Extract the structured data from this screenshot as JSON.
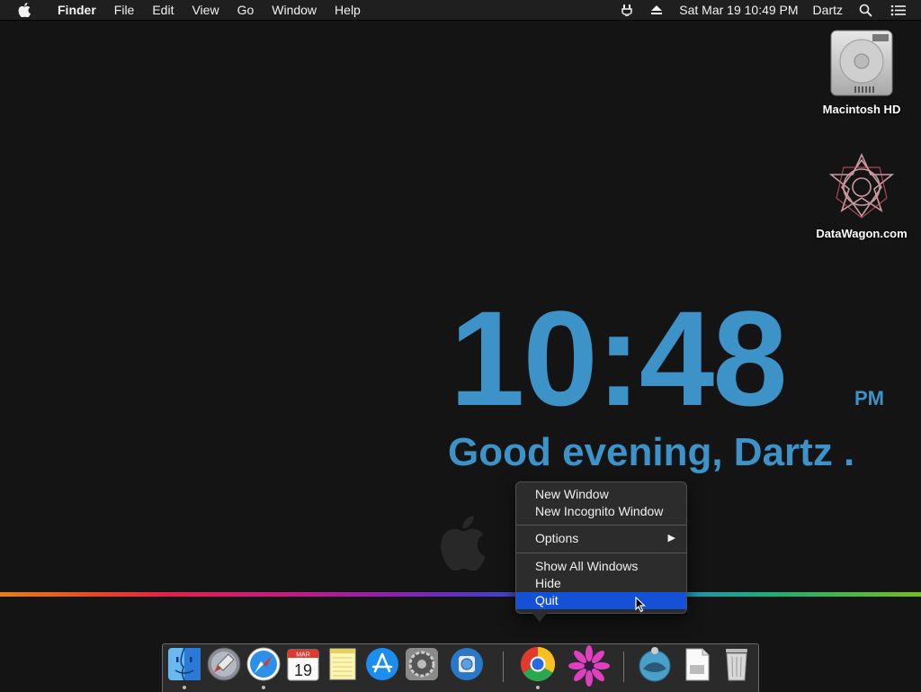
{
  "menubar": {
    "app_name": "Finder",
    "items": [
      "File",
      "Edit",
      "View",
      "Go",
      "Window",
      "Help"
    ],
    "datetime": "Sat Mar 19  10:49 PM",
    "user": "Dartz"
  },
  "desktop": {
    "icons": [
      {
        "label": "Macintosh HD",
        "icon": "hard-drive-icon"
      },
      {
        "label": "DataWagon.com",
        "icon": "datawagon-icon"
      }
    ]
  },
  "widget": {
    "time": "10:48",
    "ampm": "PM",
    "greeting": "Good evening, Dartz .",
    "color": "#3d92c8"
  },
  "context_menu": {
    "items": [
      "New Window",
      "New Incognito Window",
      "Options",
      "Show All Windows",
      "Hide",
      "Quit"
    ],
    "highlighted": "Quit",
    "highlight_color": "#1550d8"
  },
  "dock": {
    "apps": [
      {
        "name": "Finder",
        "icon": "finder-icon",
        "running": true
      },
      {
        "name": "Launchpad",
        "icon": "launchpad-icon",
        "running": false
      },
      {
        "name": "Safari",
        "icon": "safari-icon",
        "running": true
      },
      {
        "name": "Calendar",
        "icon": "calendar-icon",
        "running": false,
        "month": "MAR",
        "day": "19"
      },
      {
        "name": "Notes",
        "icon": "notes-icon",
        "running": false
      },
      {
        "name": "App Store",
        "icon": "app-store-icon",
        "running": false
      },
      {
        "name": "System Preferences",
        "icon": "system-preferences-icon",
        "running": false
      },
      {
        "name": "Time Machine",
        "icon": "time-machine-icon",
        "running": false
      },
      {
        "name": "Google Chrome",
        "icon": "chrome-icon",
        "running": true
      },
      {
        "name": "Flower",
        "icon": "flower-icon",
        "running": false
      },
      {
        "name": "Downloads",
        "icon": "downloads-icon",
        "running": false
      },
      {
        "name": "Document",
        "icon": "document-icon",
        "running": false
      },
      {
        "name": "Trash",
        "icon": "trash-icon",
        "running": false
      }
    ]
  }
}
